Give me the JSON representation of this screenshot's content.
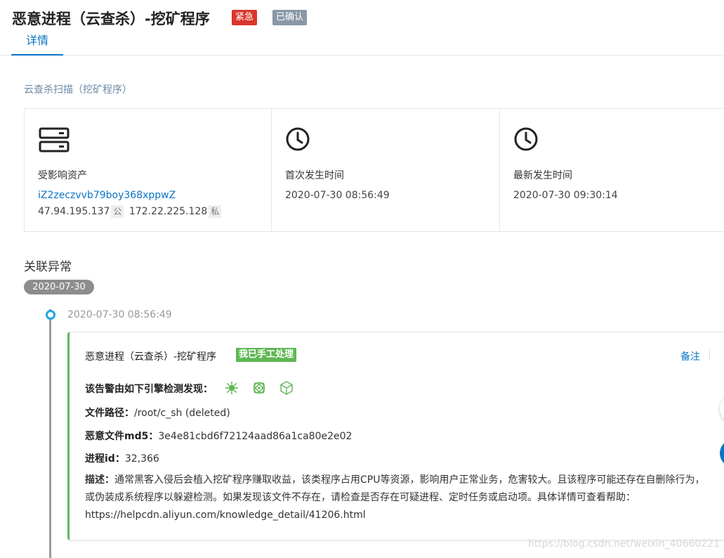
{
  "header": {
    "title": "恶意进程（云查杀）-挖矿程序",
    "badge_urgent": "紧急",
    "badge_confirmed": "已确认",
    "tab_details": "详情"
  },
  "scan_label": "云查杀扫描（挖矿程序）",
  "cards": {
    "asset": {
      "label": "受影响资产",
      "instance_id": "iZ2zeczvvb79boy368xppwZ",
      "public_ip": "47.94.195.137",
      "public_tag": "公",
      "private_ip": "172.22.225.128",
      "private_tag": "私"
    },
    "first_time": {
      "label": "首次发生时间",
      "value": "2020-07-30 08:56:49"
    },
    "last_time": {
      "label": "最新发生时间",
      "value": "2020-07-30 09:30:14"
    }
  },
  "related": {
    "title": "关联异常",
    "date": "2020-07-30",
    "event_time": "2020-07-30 08:56:49",
    "event": {
      "title": "恶意进程（云查杀）-挖矿程序",
      "status_badge": "我已手工处理",
      "note_link": "备注",
      "engines_label": "该告警由如下引擎检测发现：",
      "path_label": "文件路径：",
      "path_value": "/root/c_sh (deleted)",
      "md5_label": "恶意文件md5：",
      "md5_value": "3e4e81cbd6f72124aad86a1ca80e2e02",
      "pid_label": "进程id：",
      "pid_value": "32,366",
      "desc_label": "描述：",
      "desc_value": "通常黑客入侵后会植入挖矿程序赚取收益，该类程序占用CPU等资源，影响用户正常业务，危害较大。且该程序可能还存在自删除行为，或伪装成系统程序以躲避检测。如果发现该文件不存在，请检查是否存在可疑进程、定时任务或启动项。具体详情可查看帮助：https://helpcdn.aliyun.com/knowledge_detail/41206.html"
    }
  },
  "watermark": "https://blog.csdn.net/weixin_40660221",
  "icons": [
    "server-icon",
    "clock-icon",
    "virus-icon",
    "atom-icon",
    "cube-icon"
  ],
  "colors": {
    "accent": "#0a74c6",
    "urgent": "#d9362b",
    "handled": "#5fb854",
    "timeline_dot": "#1fa7e3"
  }
}
